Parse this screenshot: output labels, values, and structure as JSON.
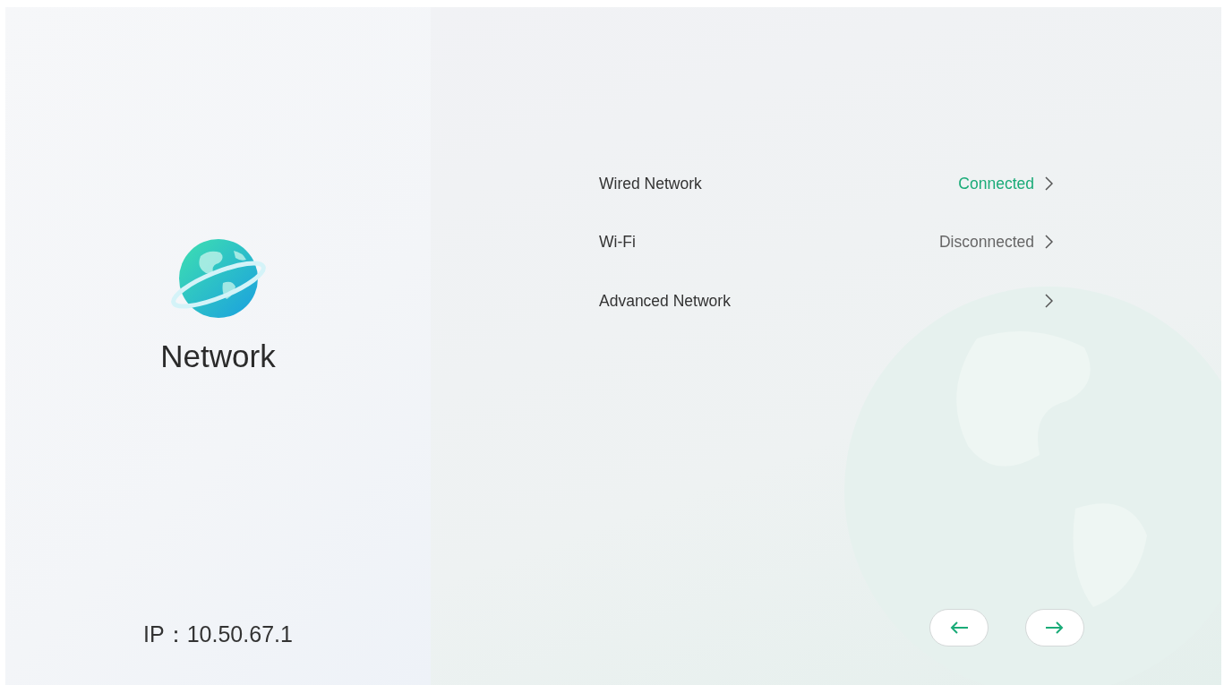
{
  "sidebar": {
    "title": "Network",
    "ip": "IP：10.50.67.1"
  },
  "rows": [
    {
      "label": "Wired Network",
      "status": "Connected",
      "connected": true
    },
    {
      "label": "Wi-Fi",
      "status": "Disconnected",
      "connected": false
    },
    {
      "label": "Advanced Network"
    }
  ],
  "nav_buttons": [
    {
      "kind": "back"
    },
    {
      "kind": "next"
    }
  ]
}
